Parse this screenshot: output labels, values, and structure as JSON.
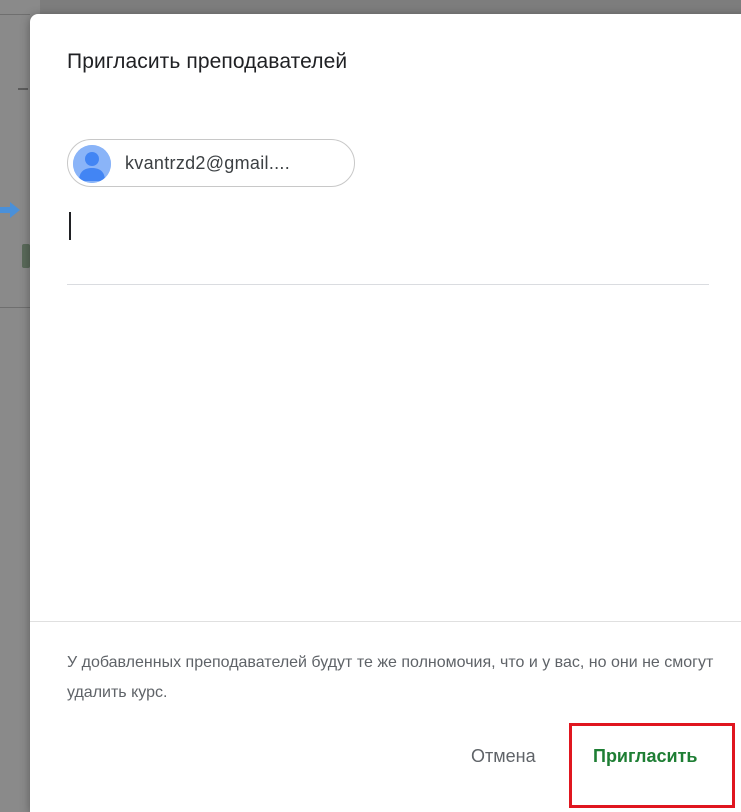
{
  "dialog": {
    "title": "Пригласить преподавателей",
    "chips": [
      {
        "label": "kvantrzd2@gmail...."
      }
    ],
    "input": {
      "value": ""
    },
    "note": "У добавленных преподавателей будут те же полномочия, что и у вас, но они не смогут удалить курс.",
    "buttons": {
      "cancel": "Отмена",
      "invite": "Пригласить"
    }
  },
  "icons": {
    "avatar": "person-avatar-icon",
    "arrow": "arrow-right-icon"
  },
  "colors": {
    "invite_text": "#1e7e34",
    "highlight": "#e0161f",
    "avatar_bg": "#8ab4f8",
    "avatar_fg": "#4285f4",
    "arrow": "#4a90d9"
  }
}
